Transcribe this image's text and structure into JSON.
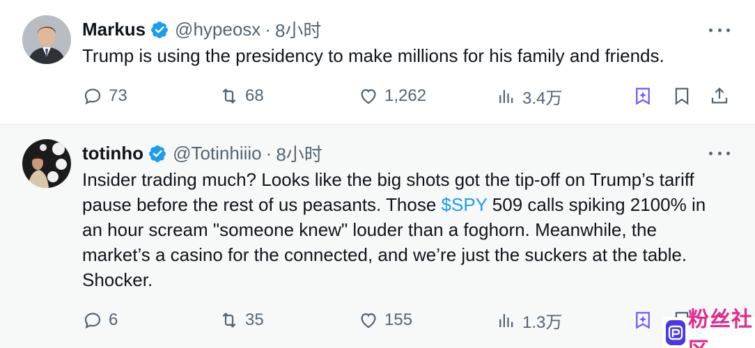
{
  "tweets": [
    {
      "name": "Markus",
      "handle": "@hypeosx",
      "separator": "·",
      "time": "8小时",
      "text": "Trump is using the presidency to make millions for his family and friends.",
      "replies": "73",
      "retweets": "68",
      "likes": "1,262",
      "views": "3.4万"
    },
    {
      "name": "totinho",
      "handle": "@Totinhiiio",
      "separator": "·",
      "time": "8小时",
      "text_before": "Insider trading much? Looks like the big shots got the tip-off on Trump’s tariff pause before the rest of us peasants. Those ",
      "cashtag": "$SPY",
      "text_after": " 509 calls spiking 2100% in an hour scream \"someone knew\" louder than a foghorn. Meanwhile, the market’s a casino for the connected, and we’re just the suckers at the table. Shocker.",
      "replies": "6",
      "retweets": "35",
      "likes": "155",
      "views": "1.3万"
    }
  ],
  "icons": {
    "verified": "verified-badge-icon",
    "more": "more-horizontal-icon",
    "reply": "reply-icon",
    "retweet": "retweet-icon",
    "like": "heart-icon",
    "views": "views-chart-icon",
    "grok": "grok-icon",
    "bookmark": "bookmark-icon",
    "share": "share-icon"
  },
  "colors": {
    "verified": "#1d9bf0",
    "link": "#1d9bf0",
    "grok": "#7856ff",
    "muted": "#536471",
    "text": "#0f1419",
    "watermark_logo": "#4a38e6",
    "watermark_text": "#e02a8d"
  },
  "watermark": {
    "text": "粉丝社区"
  }
}
